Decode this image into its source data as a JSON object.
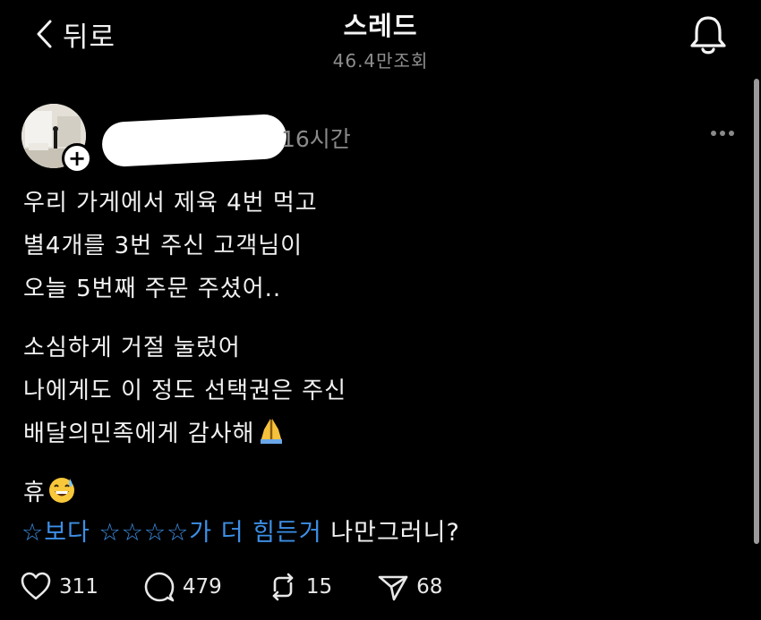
{
  "nav": {
    "back_label": "뒤로",
    "title": "스레드",
    "views": "46.4만조회"
  },
  "post": {
    "time": "16시간",
    "body_lines": [
      "우리 가게에서 제육 4번 먹고",
      "별4개를 3번 주신 고객님이",
      "오늘 5번째 주문 주셨어..",
      "소심하게 거절 눌렀어",
      "나에게도 이 정도 선택권은 주신",
      "배달의민족에게 감사해"
    ],
    "sigh": "휴",
    "tag_link_1": "☆보다 ☆☆☆☆가 더",
    "tag_link_2": "힘든거",
    "tag_text": "나만그러니?"
  },
  "actions": {
    "likes": "311",
    "comments": "479",
    "reposts": "15",
    "shares": "68"
  },
  "colors": {
    "background": "#000000",
    "text": "#f2f2f2",
    "muted": "#8e8e8e",
    "link": "#3d8fe6"
  }
}
